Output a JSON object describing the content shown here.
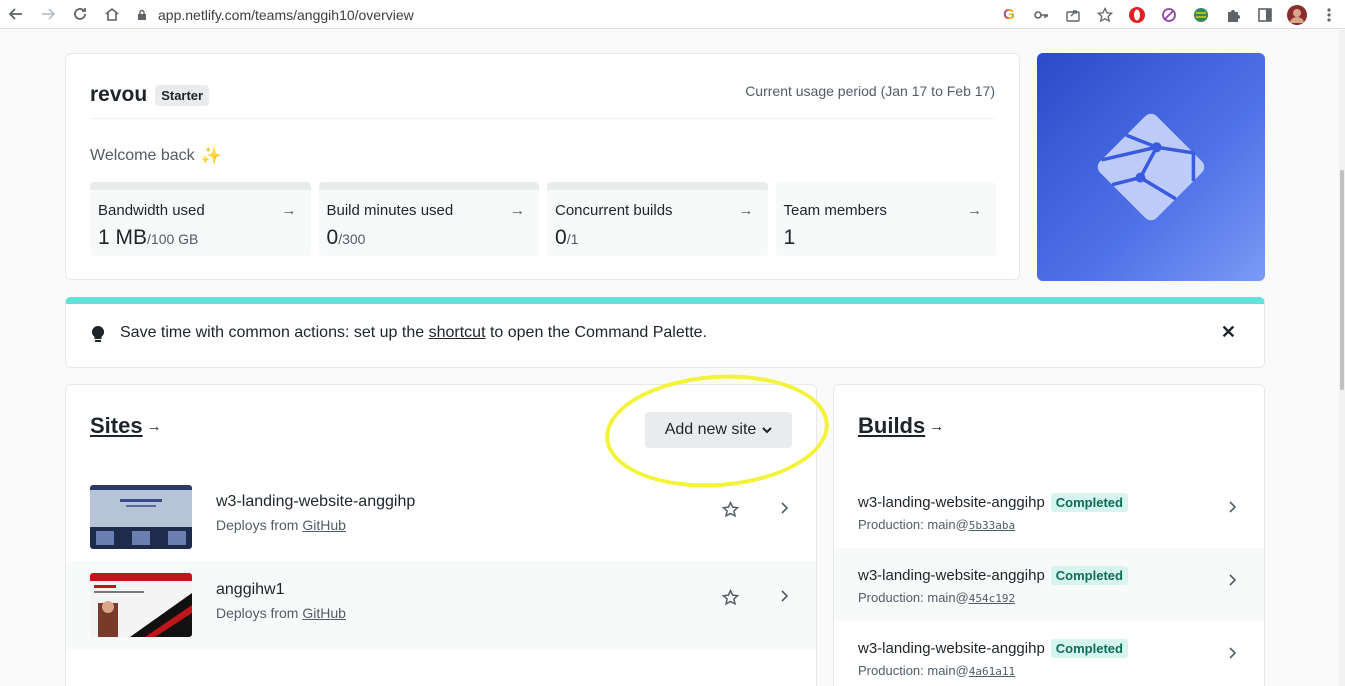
{
  "browser": {
    "url": "app.netlify.com/teams/anggih10/overview",
    "back_icon": "arrow-left-icon",
    "forward_icon": "arrow-right-icon"
  },
  "team": {
    "name": "revou",
    "plan": "Starter",
    "usage_period": "Current usage period (Jan 17 to Feb 17)",
    "welcome": "Welcome back",
    "stats": [
      {
        "label": "Bandwidth used",
        "value": "1 MB",
        "of": "/100 GB"
      },
      {
        "label": "Build minutes used",
        "value": "0",
        "of": "/300"
      },
      {
        "label": "Concurrent builds",
        "value": "0",
        "of": "/1"
      },
      {
        "label": "Team members",
        "value": "1",
        "of": ""
      }
    ]
  },
  "tip": {
    "prefix": "Save time with common actions: set up the ",
    "link": "shortcut",
    "suffix": " to open the Command Palette.",
    "close": "✕"
  },
  "sites": {
    "title": "Sites",
    "arrow": "→",
    "add_button": "Add new site",
    "items": [
      {
        "name": "w3-landing-website-anggihp",
        "deploys_prefix": "Deploys from ",
        "source": "GitHub"
      },
      {
        "name": "anggihw1",
        "deploys_prefix": "Deploys from ",
        "source": "GitHub"
      }
    ]
  },
  "builds": {
    "title": "Builds",
    "arrow": "→",
    "items": [
      {
        "name": "w3-landing-website-anggihp",
        "status": "Completed",
        "meta": "Production: main@",
        "hash": "5b33aba"
      },
      {
        "name": "w3-landing-website-anggihp",
        "status": "Completed",
        "meta": "Production: main@",
        "hash": "454c192"
      },
      {
        "name": "w3-landing-website-anggihp",
        "status": "Completed",
        "meta": "Production: main@",
        "hash": "4a61a11"
      }
    ]
  },
  "colors": {
    "accent_teal": "#61e3dc",
    "highlight_yellow": "#f3f33a",
    "completed_bg": "#d7f5ef",
    "completed_text": "#0e6c57"
  }
}
